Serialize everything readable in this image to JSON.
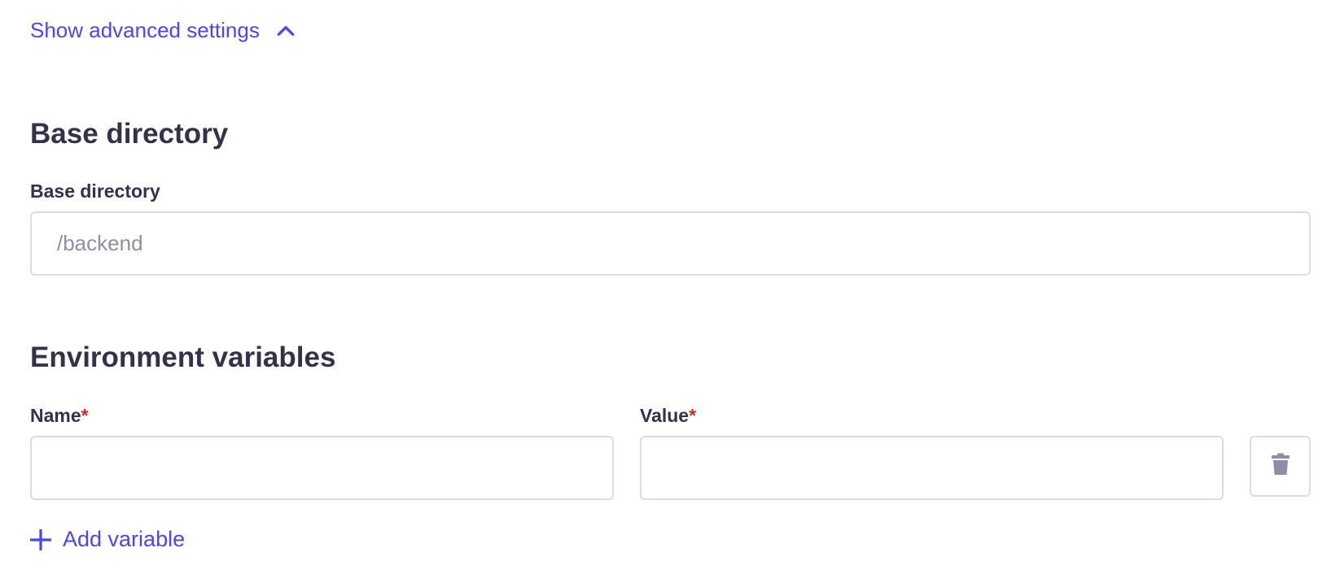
{
  "advanced": {
    "toggle_label": "Show advanced settings",
    "icon": "chevron-up-icon"
  },
  "base_directory": {
    "section_title": "Base directory",
    "field_label": "Base directory",
    "placeholder": "/backend",
    "value": ""
  },
  "env_vars": {
    "section_title": "Environment variables",
    "name_label": "Name",
    "value_label": "Value",
    "required_mark": "*",
    "name_value": "",
    "value_value": "",
    "delete_icon": "trash-icon",
    "add_label": "Add variable",
    "add_icon": "plus-icon"
  },
  "colors": {
    "accent": "#4945ff",
    "text": "#32324d",
    "placeholder": "#8e8ea9",
    "border": "#dcdce4",
    "required": "#d02b20",
    "icon": "#8e8ea9"
  }
}
